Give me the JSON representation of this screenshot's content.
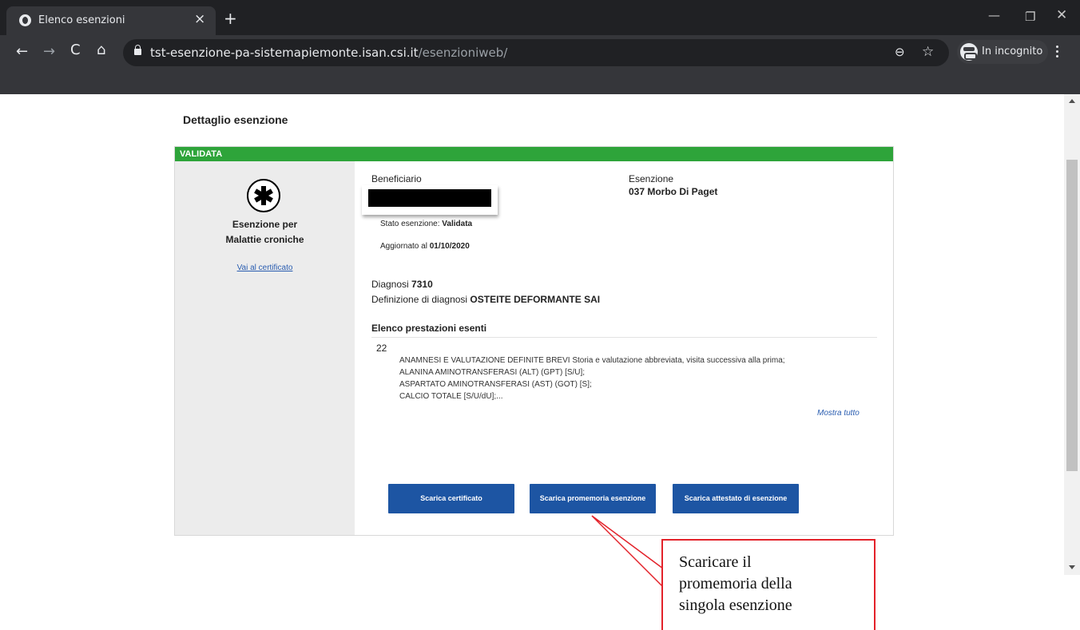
{
  "browser": {
    "tab_title": "Elenco esenzioni",
    "tab_close": "×",
    "new_tab": "+",
    "url_host": "tst-esenzione-pa-sistemapiemonte.isan.csi.it",
    "url_path": "/esenzioniweb/",
    "incognito_label": "In incognito",
    "nav_back": "←",
    "nav_forward": "→",
    "nav_reload": "C",
    "nav_home": "⌂",
    "win_min": "—",
    "win_max": "❐",
    "win_close": "✕",
    "zoom": "⊖",
    "star": "☆"
  },
  "page": {
    "title": "Dettaglio esenzione"
  },
  "card": {
    "status": "VALIDATA",
    "status_color": "#2ea43a",
    "exemption_type_line1": "Esenzione per",
    "exemption_type_line2": "Malattie croniche",
    "certificate_link": "Vai al certificato",
    "beneficiary_label": "Beneficiario",
    "exemption_label": "Esenzione",
    "exemption_value": "037 Morbo Di Paget",
    "status_label": "Stato esenzione:",
    "status_value": "Validata",
    "updated_label": "Aggiornato al",
    "updated_value": "01/10/2020",
    "diagnosis_label": "Diagnosi",
    "diagnosis_value": "7310",
    "definition_label": "Definizione di diagnosi",
    "definition_value": "OSTEITE DEFORMANTE SAI",
    "services_title": "Elenco prestazioni esenti",
    "services_count": "22",
    "services": [
      "ANAMNESI E VALUTAZIONE DEFINITE BREVI Storia e valutazione abbreviata, visita successiva alla prima;",
      "ALANINA AMINOTRANSFERASI (ALT) (GPT) [S/U];",
      "ASPARTATO AMINOTRANSFERASI (AST) (GOT) [S];",
      "CALCIO TOTALE [S/U/dU];..."
    ],
    "show_all": "Mostra tutto",
    "buttons": {
      "download_certificate": "Scarica certificato",
      "download_reminder": "Scarica promemoria esenzione",
      "download_attestation": "Scarica attestato di esenzione"
    },
    "primary_button_color": "#1d55a3"
  },
  "annotation": {
    "line1": "Scaricare il",
    "line2": "promemoria della",
    "line3": "singola esenzione",
    "color": "#e3222a"
  }
}
